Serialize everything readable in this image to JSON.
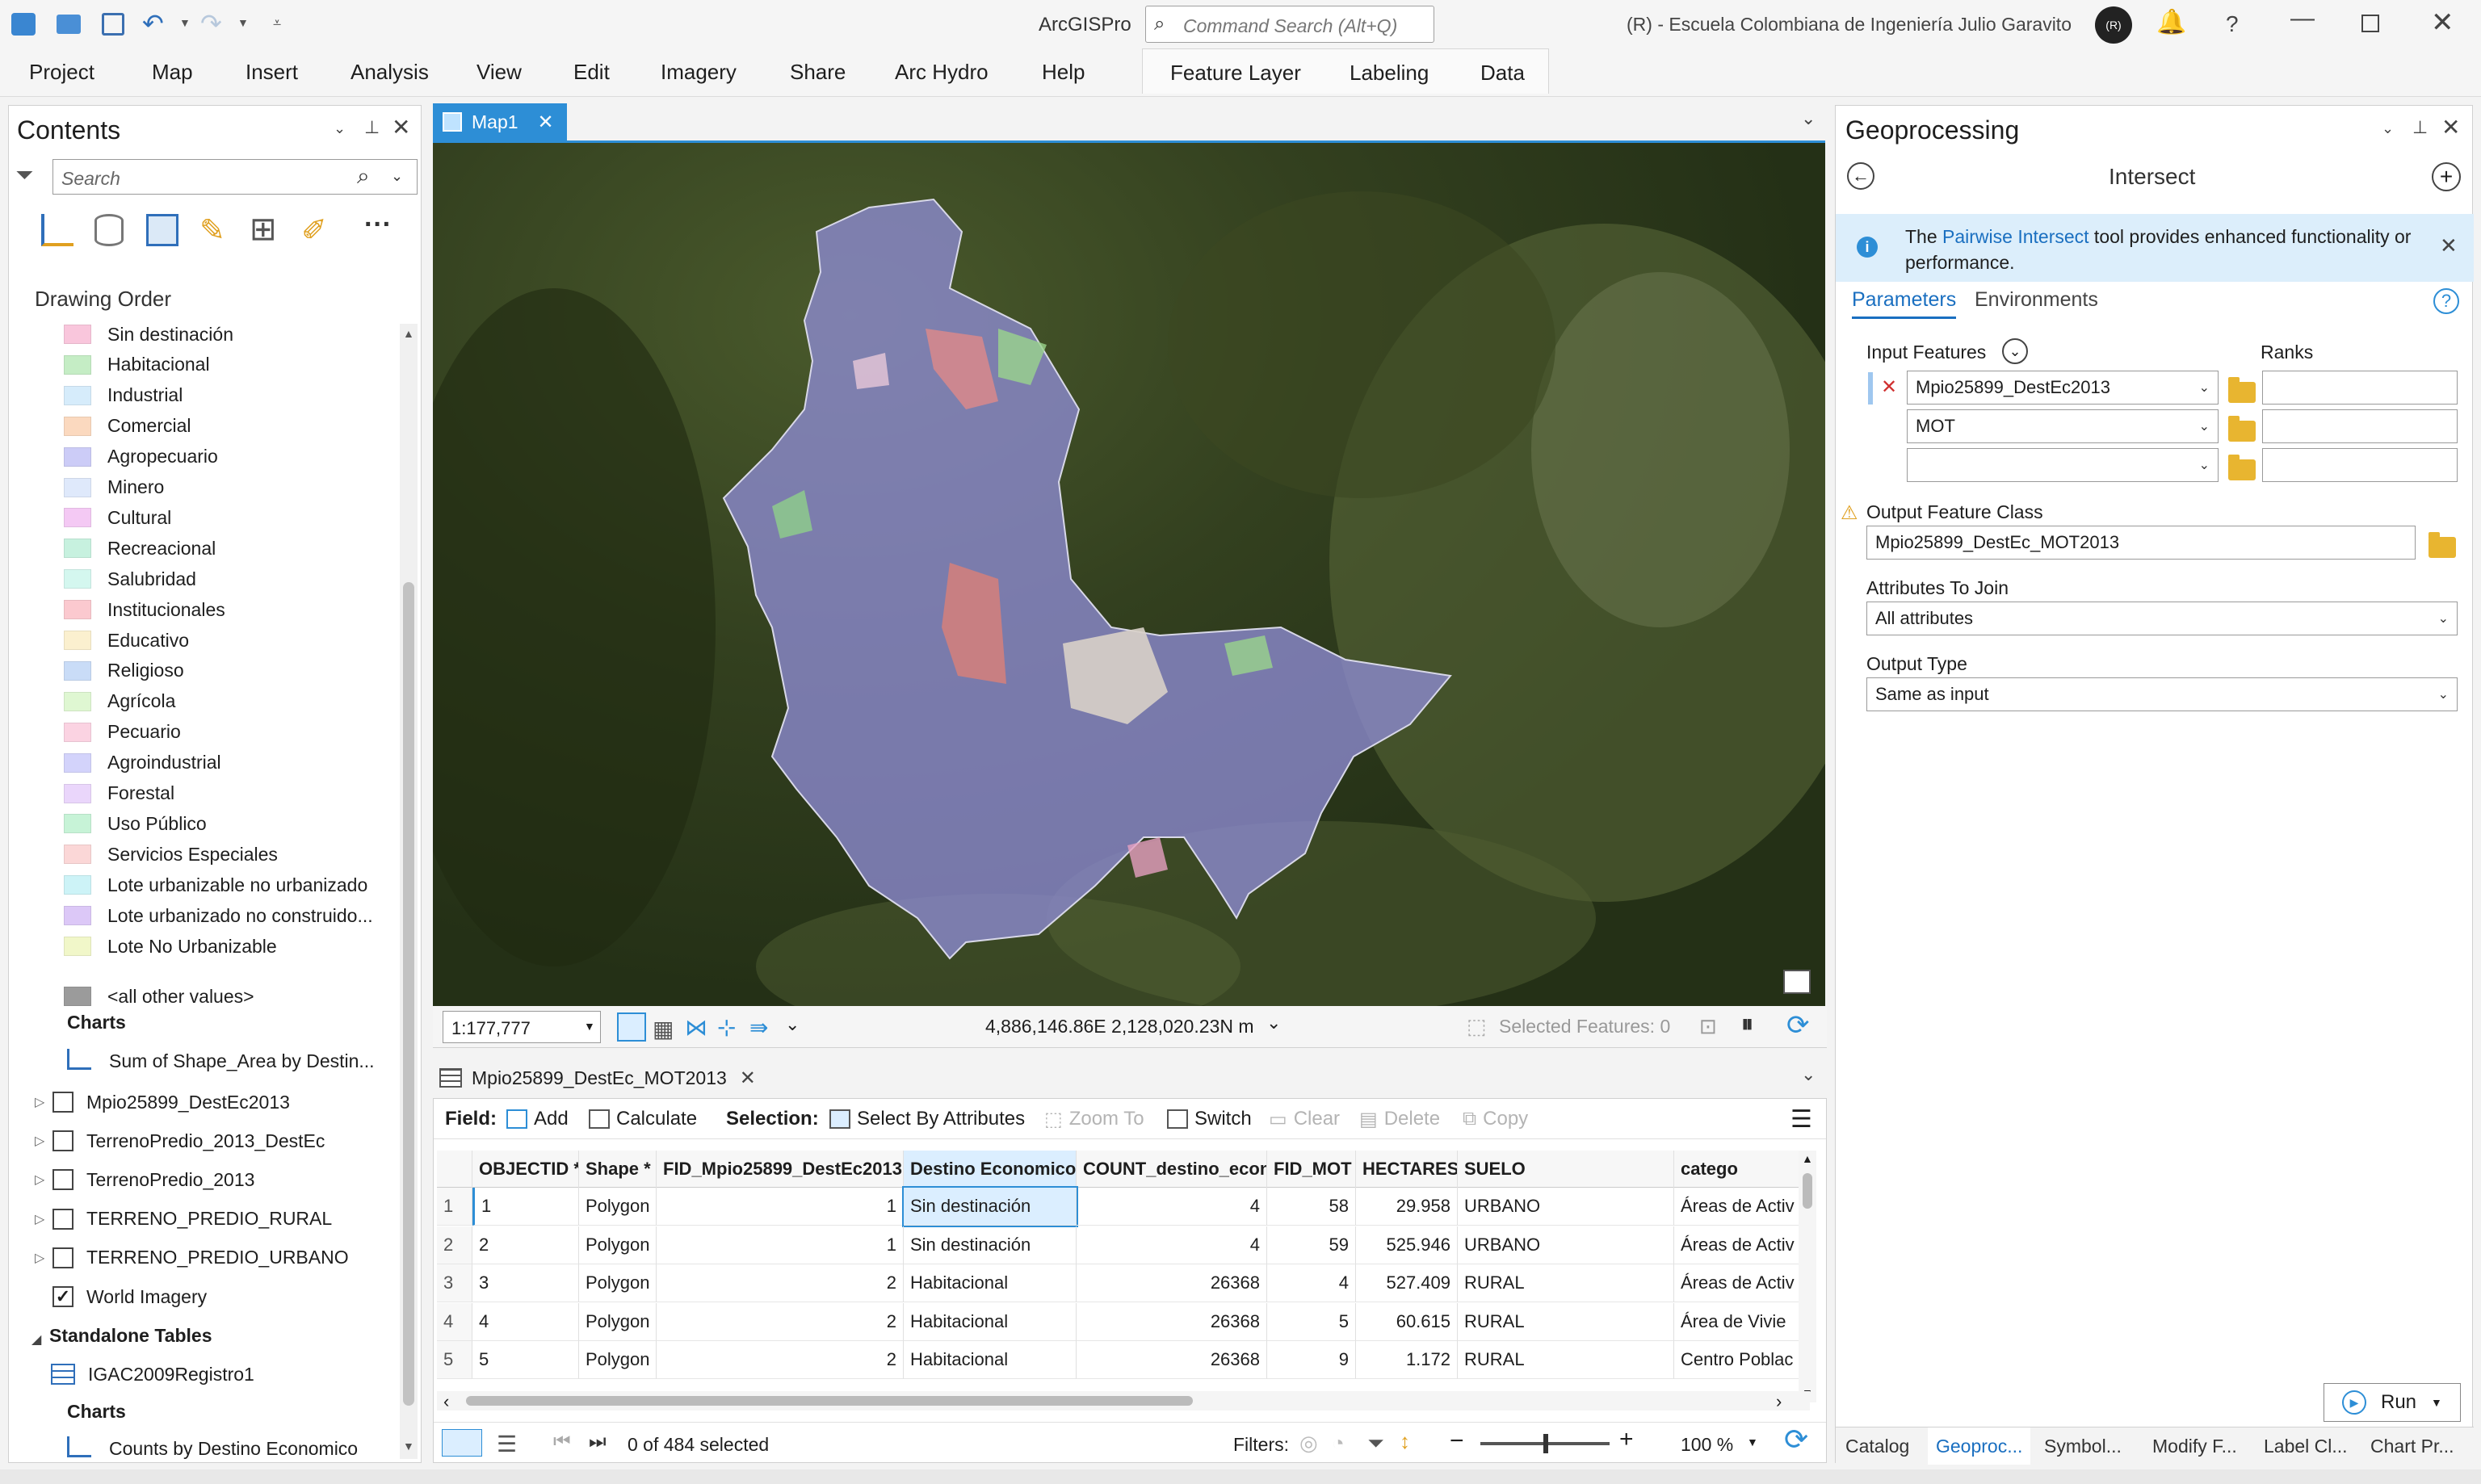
{
  "app": {
    "title": "ArcGISPro",
    "command_search_placeholder": "Command Search (Alt+Q)",
    "org": "(R) - Escuela Colombiana de Ingeniería Julio Garavito",
    "user_initials": "(R)"
  },
  "ribbon": {
    "tabs": [
      "Project",
      "Map",
      "Insert",
      "Analysis",
      "View",
      "Edit",
      "Imagery",
      "Share",
      "Arc Hydro",
      "Help"
    ],
    "context_tabs": [
      "Feature Layer",
      "Labeling",
      "Data"
    ]
  },
  "contents": {
    "title": "Contents",
    "search_placeholder": "Search",
    "drawing_order": "Drawing Order",
    "legend": [
      {
        "label": "Sin destinación",
        "color": "#f9c6dc"
      },
      {
        "label": "Habitacional",
        "color": "#c5edc5"
      },
      {
        "label": "Industrial",
        "color": "#d6ecfb"
      },
      {
        "label": "Comercial",
        "color": "#fbd9bf"
      },
      {
        "label": "Agropecuario",
        "color": "#ccccf7"
      },
      {
        "label": "Minero",
        "color": "#dfe9fb"
      },
      {
        "label": "Cultural",
        "color": "#f4c9f4"
      },
      {
        "label": "Recreacional",
        "color": "#c7f1df"
      },
      {
        "label": "Salubridad",
        "color": "#d4f7ef"
      },
      {
        "label": "Institucionales",
        "color": "#fbc9cf"
      },
      {
        "label": "Educativo",
        "color": "#fbf0cf"
      },
      {
        "label": "Religioso",
        "color": "#c9dcf7"
      },
      {
        "label": "Agrícola",
        "color": "#dff7d2"
      },
      {
        "label": "Pecuario",
        "color": "#fbd3e2"
      },
      {
        "label": "Agroindustrial",
        "color": "#d3d3fb"
      },
      {
        "label": "Forestal",
        "color": "#ead6fb"
      },
      {
        "label": "Uso Público",
        "color": "#c7f3d7"
      },
      {
        "label": "Servicios Especiales",
        "color": "#fbd7d7"
      },
      {
        "label": "Lote urbanizable no urbanizado",
        "color": "#cdf3f7"
      },
      {
        "label": "Lote urbanizado no construido...",
        "color": "#dcc8f7"
      },
      {
        "label": "Lote No Urbanizable",
        "color": "#f1f7c9"
      },
      {
        "label": "<all other values>",
        "color": "#9b9b9b"
      }
    ],
    "charts_heading": "Charts",
    "chart_item": "Sum of Shape_Area by Destin...",
    "layers": [
      {
        "label": "Mpio25899_DestEc2013",
        "checked": false
      },
      {
        "label": "TerrenoPredio_2013_DestEc",
        "checked": false
      },
      {
        "label": "TerrenoPredio_2013",
        "checked": false
      },
      {
        "label": "TERRENO_PREDIO_RURAL",
        "checked": false
      },
      {
        "label": "TERRENO_PREDIO_URBANO",
        "checked": false
      },
      {
        "label": "World Imagery",
        "checked": true
      }
    ],
    "check_mark": "✓",
    "standalone_heading": "Standalone Tables",
    "standalone_table": "IGAC2009Registro1",
    "charts_heading2": "Charts",
    "chart_item2": "Counts by Destino Economico"
  },
  "map": {
    "tab": "Map1",
    "scale": "1:177,777",
    "coords": "4,886,146.86E 2,128,020.23N m",
    "selected": "Selected Features: 0"
  },
  "table": {
    "tab": "Mpio25899_DestEc_MOT2013",
    "toolbar": {
      "field": "Field:",
      "add": "Add",
      "calculate": "Calculate",
      "selection": "Selection:",
      "select_by_attr": "Select By Attributes",
      "zoom_to": "Zoom To",
      "switch": "Switch",
      "clear": "Clear",
      "delete": "Delete",
      "copy": "Copy"
    },
    "columns": [
      "OBJECTID *",
      "Shape *",
      "FID_Mpio25899_DestEc2013",
      "Destino Economico",
      "COUNT_destino_econ",
      "FID_MOT",
      "HECTARES",
      "SUELO",
      "catego"
    ],
    "rows": [
      [
        "1",
        "1",
        "Polygon",
        "1",
        "Sin destinación",
        "4",
        "58",
        "29.958",
        "URBANO",
        "Áreas de Activ"
      ],
      [
        "2",
        "2",
        "Polygon",
        "1",
        "Sin destinación",
        "4",
        "59",
        "525.946",
        "URBANO",
        "Áreas de Activ"
      ],
      [
        "3",
        "3",
        "Polygon",
        "2",
        "Habitacional",
        "26368",
        "4",
        "527.409",
        "RURAL",
        "Áreas de Activ"
      ],
      [
        "4",
        "4",
        "Polygon",
        "2",
        "Habitacional",
        "26368",
        "5",
        "60.615",
        "RURAL",
        "Área de Vivie"
      ],
      [
        "5",
        "5",
        "Polygon",
        "2",
        "Habitacional",
        "26368",
        "9",
        "1.172",
        "RURAL",
        "Centro Poblac"
      ]
    ],
    "status": "0 of 484 selected",
    "filters": "Filters:",
    "zoom": "100 %"
  },
  "gp": {
    "title": "Geoprocessing",
    "tool": "Intersect",
    "info_pre": "The ",
    "info_link": "Pairwise Intersect",
    "info_post": " tool provides enhanced functionality or performance.",
    "tab_params": "Parameters",
    "tab_env": "Environments",
    "input_features": "Input Features",
    "ranks": "Ranks",
    "inputs": [
      "Mpio25899_DestEc2013",
      "MOT",
      ""
    ],
    "output_label": "Output Feature Class",
    "output_value": "Mpio25899_DestEc_MOT2013",
    "attr_label": "Attributes To Join",
    "attr_value": "All attributes",
    "type_label": "Output Type",
    "type_value": "Same as input",
    "run": "Run",
    "bottom_tabs": [
      "Catalog",
      "Geoproc...",
      "Symbol...",
      "Modify F...",
      "Label Cl...",
      "Chart Pr..."
    ]
  }
}
